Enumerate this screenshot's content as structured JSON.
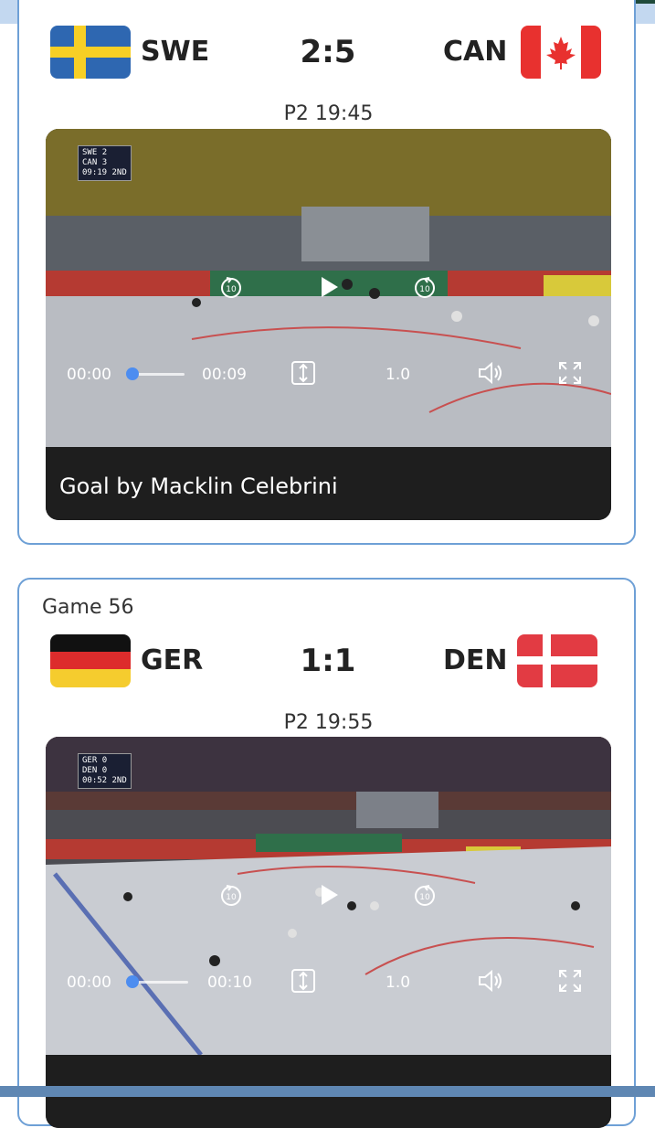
{
  "games": [
    {
      "label": "",
      "home": {
        "code": "SWE",
        "flag": "sweden-flag-icon"
      },
      "away": {
        "code": "CAN",
        "flag": "canada-flag-icon"
      },
      "score": "2:5",
      "period_time": "P2 19:45",
      "video": {
        "current_time": "00:00",
        "duration": "00:09",
        "progress": 0,
        "speed": "1.0",
        "caption": "Goal by Macklin Celebrini",
        "overlay": {
          "line1_team": "SWE",
          "line1_score": "2",
          "line2_team": "CAN",
          "line2_score": "3",
          "clock": "09:19  2ND"
        }
      }
    },
    {
      "label": "Game 56",
      "home": {
        "code": "GER",
        "flag": "germany-flag-icon"
      },
      "away": {
        "code": "DEN",
        "flag": "denmark-flag-icon"
      },
      "score": "1:1",
      "period_time": "P2 19:55",
      "video": {
        "current_time": "00:00",
        "duration": "00:10",
        "progress": 0,
        "speed": "1.0",
        "caption": "",
        "overlay": {
          "line1_team": "GER",
          "line1_score": "0",
          "line2_team": "DEN",
          "line2_score": "0",
          "clock": "00:52  2ND"
        }
      }
    }
  ],
  "icons": {
    "play": "play-icon",
    "rewind": "rewind-10-icon",
    "forward": "forward-10-icon",
    "fit": "fit-screen-icon",
    "volume": "volume-icon",
    "fullscreen": "fullscreen-icon"
  },
  "colors": {
    "accent": "#4d8df0",
    "card_border": "#6ea0d6",
    "caption_bg": "#1e1e1e"
  }
}
